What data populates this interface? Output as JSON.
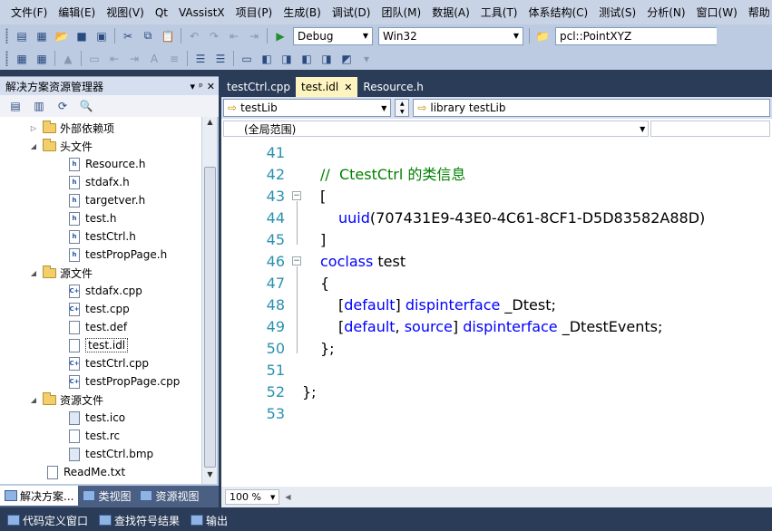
{
  "menu": [
    "文件(F)",
    "编辑(E)",
    "视图(V)",
    "Qt",
    "VAssistX",
    "项目(P)",
    "生成(B)",
    "调试(D)",
    "团队(M)",
    "数据(A)",
    "工具(T)",
    "体系结构(C)",
    "测试(S)",
    "分析(N)",
    "窗口(W)",
    "帮助"
  ],
  "toolbar": {
    "config": "Debug",
    "platform": "Win32",
    "find_value": "pcl::PointXYZ"
  },
  "solution_explorer": {
    "title": "解决方案资源管理器",
    "pin": "ᵖ",
    "close": "✕",
    "items": [
      {
        "label": "外部依赖项",
        "type": "folder",
        "level": 1,
        "expander": "▷"
      },
      {
        "label": "头文件",
        "type": "folder",
        "level": 1,
        "expander": "◢"
      },
      {
        "label": "Resource.h",
        "type": "h",
        "level": 2
      },
      {
        "label": "stdafx.h",
        "type": "h",
        "level": 2
      },
      {
        "label": "targetver.h",
        "type": "h",
        "level": 2
      },
      {
        "label": "test.h",
        "type": "h",
        "level": 2
      },
      {
        "label": "testCtrl.h",
        "type": "h",
        "level": 2
      },
      {
        "label": "testPropPage.h",
        "type": "h",
        "level": 2
      },
      {
        "label": "源文件",
        "type": "folder",
        "level": 1,
        "expander": "◢"
      },
      {
        "label": "stdafx.cpp",
        "type": "cpp",
        "level": 2
      },
      {
        "label": "test.cpp",
        "type": "cpp",
        "level": 2
      },
      {
        "label": "test.def",
        "type": "def",
        "level": 2
      },
      {
        "label": "test.idl",
        "type": "idl",
        "level": 2,
        "selected": true
      },
      {
        "label": "testCtrl.cpp",
        "type": "cpp",
        "level": 2
      },
      {
        "label": "testPropPage.cpp",
        "type": "cpp",
        "level": 2
      },
      {
        "label": "资源文件",
        "type": "folder",
        "level": 1,
        "expander": "◢"
      },
      {
        "label": "test.ico",
        "type": "img",
        "level": 2
      },
      {
        "label": "test.rc",
        "type": "rc",
        "level": 2
      },
      {
        "label": "testCtrl.bmp",
        "type": "img",
        "level": 2
      },
      {
        "label": "ReadMe.txt",
        "type": "txt",
        "level": 1
      }
    ],
    "tabs": [
      "解决方案...",
      "类视图",
      "资源视图"
    ]
  },
  "editor": {
    "tabs": [
      {
        "label": "testCtrl.cpp",
        "active": false
      },
      {
        "label": "test.idl",
        "active": true,
        "close": "✕"
      },
      {
        "label": "Resource.h",
        "active": false
      }
    ],
    "nav_left": "testLib",
    "nav_right": "library testLib",
    "scope": "(全局范围)",
    "zoom": "100 %",
    "lines": [
      {
        "n": "41",
        "indent": 0,
        "parts": []
      },
      {
        "n": "42",
        "indent": 1,
        "parts": [
          {
            "t": "//  CtestCtrl 的类信息",
            "c": "cm"
          }
        ]
      },
      {
        "n": "43",
        "indent": 1,
        "fold": "⊟",
        "parts": [
          {
            "t": "[",
            "c": ""
          }
        ]
      },
      {
        "n": "44",
        "indent": 2,
        "parts": [
          {
            "t": "uuid",
            "c": "kw"
          },
          {
            "t": "(707431E9-43E0-4C61-8CF1-D5D83582A88D)",
            "c": ""
          }
        ]
      },
      {
        "n": "45",
        "indent": 1,
        "parts": [
          {
            "t": "]",
            "c": ""
          }
        ]
      },
      {
        "n": "46",
        "indent": 1,
        "fold": "⊟",
        "parts": [
          {
            "t": "coclass",
            "c": "kw"
          },
          {
            "t": " test",
            "c": ""
          }
        ]
      },
      {
        "n": "47",
        "indent": 1,
        "parts": [
          {
            "t": "{",
            "c": ""
          }
        ]
      },
      {
        "n": "48",
        "indent": 2,
        "parts": [
          {
            "t": "[",
            "c": ""
          },
          {
            "t": "default",
            "c": "kw"
          },
          {
            "t": "] ",
            "c": ""
          },
          {
            "t": "dispinterface",
            "c": "kw"
          },
          {
            "t": " _Dtest;",
            "c": ""
          }
        ]
      },
      {
        "n": "49",
        "indent": 2,
        "parts": [
          {
            "t": "[",
            "c": ""
          },
          {
            "t": "default",
            "c": "kw"
          },
          {
            "t": ", ",
            "c": ""
          },
          {
            "t": "source",
            "c": "kw"
          },
          {
            "t": "] ",
            "c": ""
          },
          {
            "t": "dispinterface",
            "c": "kw"
          },
          {
            "t": " _DtestEvents;",
            "c": ""
          }
        ]
      },
      {
        "n": "50",
        "indent": 1,
        "parts": [
          {
            "t": "};",
            "c": ""
          }
        ]
      },
      {
        "n": "51",
        "indent": 0,
        "parts": []
      },
      {
        "n": "52",
        "indent": 0,
        "parts": [
          {
            "t": "};",
            "c": ""
          }
        ]
      },
      {
        "n": "53",
        "indent": 0,
        "parts": []
      }
    ]
  },
  "status": [
    "代码定义窗口",
    "查找符号结果",
    "输出"
  ],
  "colors": {
    "keyword": "#0000ff",
    "comment": "#008000",
    "line_number": "#2b91af",
    "active_tab": "#fdf4bf"
  }
}
